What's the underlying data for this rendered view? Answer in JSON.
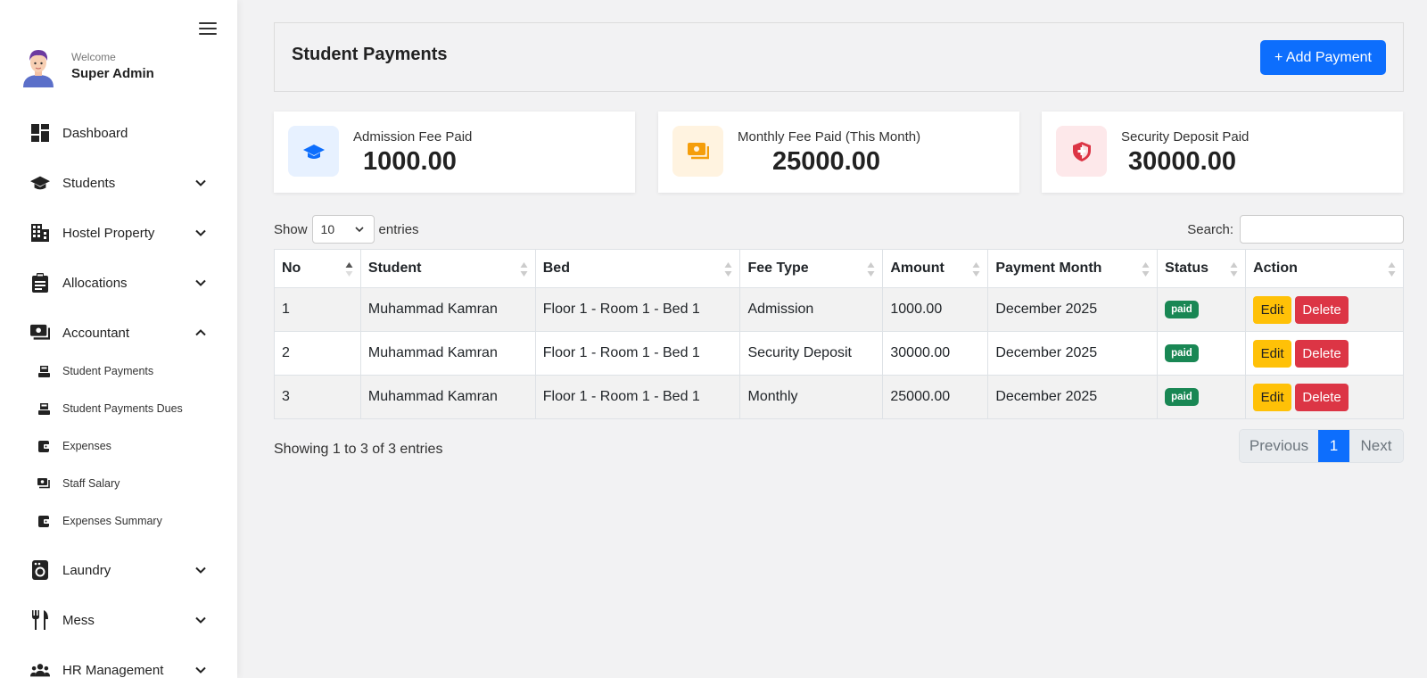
{
  "sidebar": {
    "welcome": "Welcome",
    "user_name": "Super Admin",
    "items": [
      {
        "label": "Dashboard",
        "icon": "dashboard-icon",
        "expandable": false
      },
      {
        "label": "Students",
        "icon": "graduation-cap-icon",
        "expandable": true,
        "expanded": false
      },
      {
        "label": "Hostel Property",
        "icon": "building-icon",
        "expandable": true,
        "expanded": false
      },
      {
        "label": "Allocations",
        "icon": "clipboard-icon",
        "expandable": true,
        "expanded": false
      },
      {
        "label": "Accountant",
        "icon": "money-icon",
        "expandable": true,
        "expanded": true
      },
      {
        "label": "Laundry",
        "icon": "washing-machine-icon",
        "expandable": true,
        "expanded": false
      },
      {
        "label": "Mess",
        "icon": "utensils-icon",
        "expandable": true,
        "expanded": false
      },
      {
        "label": "HR Management",
        "icon": "users-icon",
        "expandable": true,
        "expanded": false
      }
    ],
    "sub_items": [
      {
        "label": "Student Payments",
        "icon": "cash-register-icon"
      },
      {
        "label": "Student Payments Dues",
        "icon": "cash-register-icon"
      },
      {
        "label": "Expenses",
        "icon": "wallet-icon"
      },
      {
        "label": "Staff Salary",
        "icon": "money-icon"
      },
      {
        "label": "Expenses Summary",
        "icon": "wallet-icon"
      }
    ]
  },
  "header": {
    "title": "Student Payments",
    "add_button": "+ Add Payment"
  },
  "stats": [
    {
      "label": "Admission Fee Paid",
      "value": "1000.00",
      "icon": "graduation-cap-icon",
      "color": "#0d6efd",
      "bg": "#e7f1ff"
    },
    {
      "label": "Monthly Fee Paid (This Month)",
      "value": "25000.00",
      "icon": "money-icon",
      "color": "#f59e0b",
      "bg": "#fff3e0"
    },
    {
      "label": "Security Deposit Paid",
      "value": "30000.00",
      "icon": "shield-icon",
      "color": "#dc3545",
      "bg": "#fde8ea"
    }
  ],
  "table_controls": {
    "show_label": "Show",
    "entries_value": "10",
    "entries_label": "entries",
    "search_label": "Search:"
  },
  "table": {
    "columns": [
      "No",
      "Student",
      "Bed",
      "Fee Type",
      "Amount",
      "Payment Month",
      "Status",
      "Action"
    ],
    "rows": [
      {
        "no": "1",
        "student": "Muhammad Kamran",
        "bed": "Floor 1 - Room 1 - Bed 1",
        "fee_type": "Admission",
        "amount": "1000.00",
        "month": "December 2025",
        "status": "paid"
      },
      {
        "no": "2",
        "student": "Muhammad Kamran",
        "bed": "Floor 1 - Room 1 - Bed 1",
        "fee_type": "Security Deposit",
        "amount": "30000.00",
        "month": "December 2025",
        "status": "paid"
      },
      {
        "no": "3",
        "student": "Muhammad Kamran",
        "bed": "Floor 1 - Room 1 - Bed 1",
        "fee_type": "Monthly",
        "amount": "25000.00",
        "month": "December 2025",
        "status": "paid"
      }
    ],
    "edit_label": "Edit",
    "delete_label": "Delete"
  },
  "footer": {
    "info": "Showing 1 to 3 of 3 entries",
    "previous": "Previous",
    "current_page": "1",
    "next": "Next"
  }
}
